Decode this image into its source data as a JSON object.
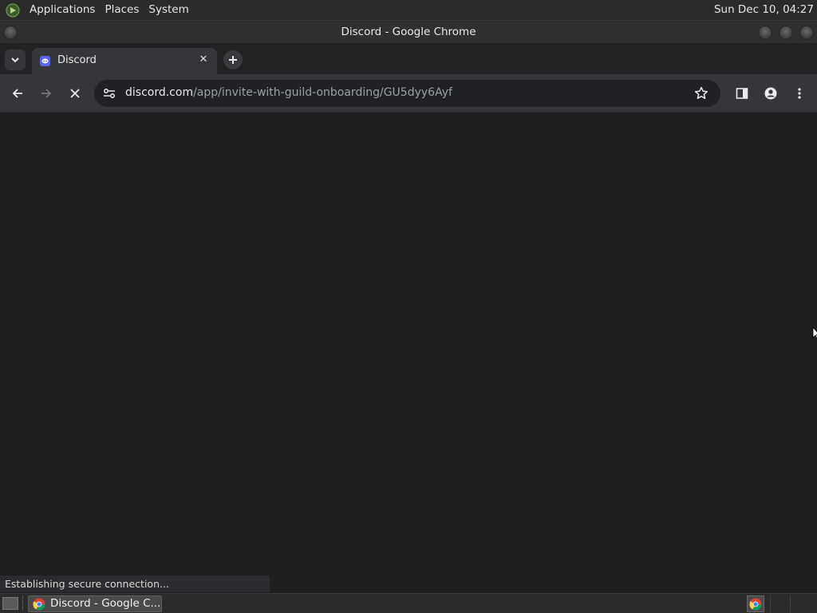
{
  "top_panel": {
    "menus": [
      "Applications",
      "Places",
      "System"
    ],
    "clock": "Sun Dec 10, 04:27"
  },
  "window": {
    "title": "Discord - Google Chrome"
  },
  "tabs": [
    {
      "title": "Discord",
      "active": true
    }
  ],
  "toolbar": {
    "url_domain": "discord.com",
    "url_path": "/app/invite-with-guild-onboarding/GU5dyy6Ayf"
  },
  "status": {
    "text": "Establishing secure connection..."
  },
  "taskbar": {
    "task_label": "Discord - Google C..."
  },
  "colors": {
    "page_background": "#1f1f22",
    "toolbar": "#35363a",
    "discord_brand": "#5865f2"
  }
}
